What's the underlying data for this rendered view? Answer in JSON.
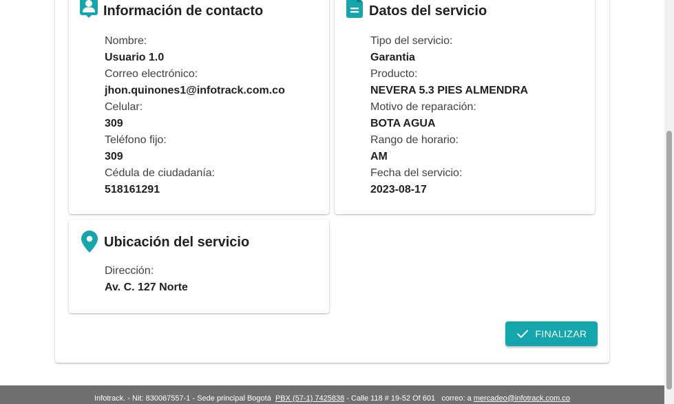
{
  "contact": {
    "title": "Información de contacto",
    "fields": [
      {
        "label": "Nombre:",
        "value": "Usuario 1.0"
      },
      {
        "label": "Correo electrónico:",
        "value": "jhon.quinones1@infotrack.com.co"
      },
      {
        "label": "Celular:",
        "value": "309"
      },
      {
        "label": "Teléfono fijo:",
        "value": "309"
      },
      {
        "label": "Cédula de ciudadanía:",
        "value": "518161291"
      }
    ]
  },
  "service": {
    "title": "Datos del servicio",
    "fields": [
      {
        "label": "Tipo del servicio:",
        "value": "Garantia"
      },
      {
        "label": "Producto:",
        "value": "NEVERA 5.3 PIES ALMENDRA"
      },
      {
        "label": "Motivo de reparación:",
        "value": "BOTA AGUA"
      },
      {
        "label": "Rango de horario:",
        "value": "AM"
      },
      {
        "label": "Fecha del servicio:",
        "value": "2023-08-17"
      }
    ]
  },
  "location": {
    "title": "Ubicación del servicio",
    "fields": [
      {
        "label": "Dirección:",
        "value": "Av. C. 127 Norte"
      }
    ]
  },
  "actions": {
    "finish_label": "FINALIZAR"
  },
  "footer": {
    "text_prefix": "Infotrack. - Nit: 830067557-1 - Sede principal Bogotá",
    "phone": "PBX (57-1) 7425838",
    "text_middle": "- Calle 118 # 19-52 Of 601   correo: a",
    "email": "mercadeo@infotrack.com.co"
  },
  "colors": {
    "accent": "#14a5ad",
    "footer_bg": "#707070"
  },
  "icons": {
    "contact": "contact-card-icon",
    "service": "document-icon",
    "location": "map-pin-icon",
    "finish": "check-icon"
  }
}
